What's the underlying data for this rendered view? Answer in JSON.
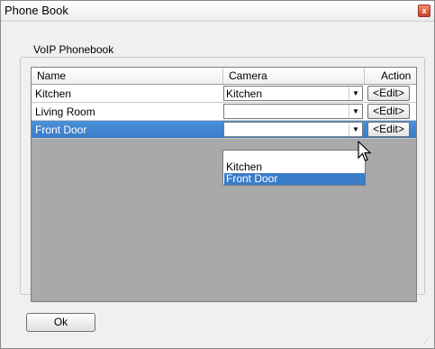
{
  "window": {
    "title": "Phone Book",
    "close_glyph": "x"
  },
  "group": {
    "label": "VoIP Phonebook"
  },
  "grid": {
    "headers": [
      "Name",
      "Camera",
      "Action"
    ],
    "rows": [
      {
        "name": "Kitchen",
        "camera": "Kitchen",
        "action": "<Edit>"
      },
      {
        "name": "Living Room",
        "camera": "",
        "action": "<Edit>"
      },
      {
        "name": "Front Door",
        "camera": "",
        "action": "<Edit>"
      }
    ],
    "dropdown_arrow": "▼"
  },
  "dropdown": {
    "options": [
      "Kitchen",
      "Front Door"
    ],
    "selected": "Front Door"
  },
  "ok_label": "Ok",
  "colors": {
    "selection": "#3b7dc8",
    "grid_bg": "#a9a9a9"
  },
  "icons": {
    "cursor": "mouse-pointer-icon",
    "close": "close-icon",
    "arrow": "chevron-down-icon"
  }
}
